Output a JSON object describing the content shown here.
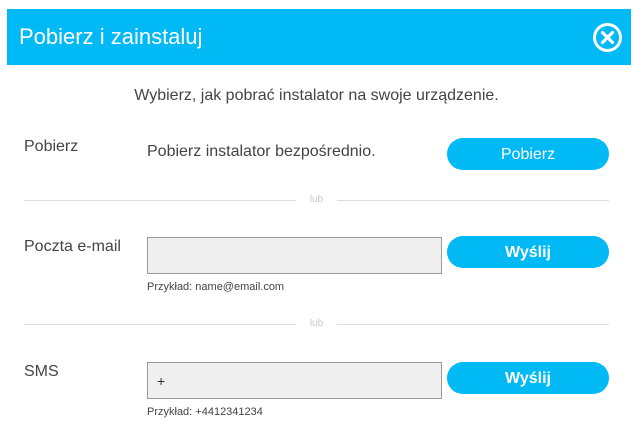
{
  "dialog": {
    "title": "Pobierz i zainstaluj",
    "close_icon": "close-circle-x",
    "accent_color": "#00b9f5",
    "subtitle": "Wybierz, jak pobrać instalator na swoje urządzenie."
  },
  "download": {
    "label": "Pobierz",
    "description": "Pobierz instalator bezpośrednio.",
    "button": "Pobierz"
  },
  "divider_text": "lub",
  "email": {
    "label": "Poczta e-mail",
    "value": "",
    "hint": "Przykład: name@email.com",
    "button": "Wyślij"
  },
  "sms": {
    "label": "SMS",
    "value": "+",
    "hint": "Przykład: +4412341234",
    "button": "Wyślij"
  }
}
